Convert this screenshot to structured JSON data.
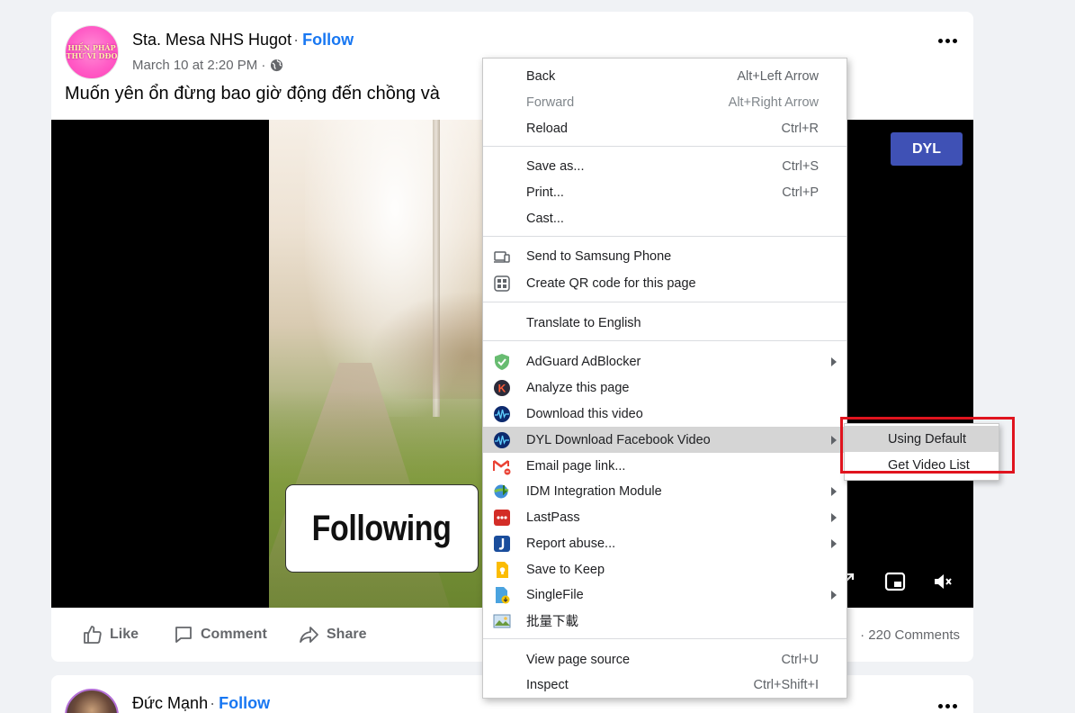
{
  "post": {
    "author": "Sta. Mesa NHS Hugot",
    "separator": "·",
    "follow_label": "Follow",
    "timestamp": "March 10 at 2:20 PM ·",
    "caption": "Muốn yên ổn đừng bao giờ động đến chồng và",
    "avatar_text": "HIẾN PHÁP THỨ VÌ DĐO",
    "video": {
      "overlay_text": "Following",
      "dyl_button": "DYL"
    },
    "actions": {
      "like": "Like",
      "comment": "Comment",
      "share": "Share",
      "comments_count": "· 220 Comments"
    }
  },
  "post2": {
    "author": "Đức Mạnh",
    "separator": "·",
    "follow_label": "Follow"
  },
  "context_menu": {
    "items": [
      {
        "label": "Back",
        "shortcut": "Alt+Left Arrow"
      },
      {
        "label": "Forward",
        "shortcut": "Alt+Right Arrow"
      },
      {
        "label": "Reload",
        "shortcut": "Ctrl+R"
      },
      {
        "label": "Save as...",
        "shortcut": "Ctrl+S"
      },
      {
        "label": "Print...",
        "shortcut": "Ctrl+P"
      },
      {
        "label": "Cast..."
      },
      {
        "label": "Send to Samsung Phone",
        "icon": "samsung-phone-icon"
      },
      {
        "label": "Create QR code for this page",
        "icon": "qr-code-icon"
      },
      {
        "label": "Translate to English"
      },
      {
        "label": "AdGuard AdBlocker",
        "icon": "adguard-shield-icon"
      },
      {
        "label": "Analyze this page",
        "icon": "analyze-k-icon"
      },
      {
        "label": "Download this video",
        "icon": "download-video-icon"
      },
      {
        "label": "DYL Download Facebook Video",
        "icon": "dyl-icon"
      },
      {
        "label": "Email page link...",
        "icon": "email-icon"
      },
      {
        "label": "IDM Integration Module",
        "icon": "idm-icon"
      },
      {
        "label": "LastPass",
        "icon": "lastpass-icon"
      },
      {
        "label": "Report abuse...",
        "icon": "report-abuse-icon"
      },
      {
        "label": "Save to Keep",
        "icon": "keep-icon"
      },
      {
        "label": "SingleFile",
        "icon": "singlefile-icon"
      },
      {
        "label": "批量下載",
        "icon": "batch-download-icon"
      },
      {
        "label": "View page source",
        "shortcut": "Ctrl+U"
      },
      {
        "label": "Inspect",
        "shortcut": "Ctrl+Shift+I"
      }
    ]
  },
  "submenu": {
    "items": [
      "Using Default",
      "Get Video List"
    ]
  },
  "colors": {
    "facebook_blue": "#1877f2",
    "dyl_button": "#3f51b5",
    "highlight_box": "#e0141e",
    "menu_highlight": "#d5d5d5"
  }
}
